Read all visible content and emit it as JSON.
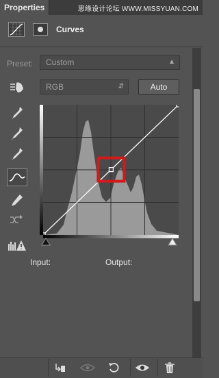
{
  "panel": {
    "tab_label": "Properties",
    "watermark": "思缘设计论坛 WWW.MISSYUAN.COM"
  },
  "header": {
    "title": "Curves",
    "adjustment_icon": "curves-grid-icon",
    "mask_icon": "mask-icon"
  },
  "preset": {
    "label": "Preset:",
    "value": "Custom"
  },
  "channel": {
    "value": "RGB"
  },
  "auto_button": {
    "label": "Auto"
  },
  "tools": [
    {
      "name": "on-image-adjust-icon"
    },
    {
      "name": "eyedropper-black-icon"
    },
    {
      "name": "eyedropper-gray-icon"
    },
    {
      "name": "eyedropper-white-icon"
    },
    {
      "name": "curve-points-icon",
      "active": true
    },
    {
      "name": "pencil-icon"
    },
    {
      "name": "smooth-icon"
    },
    {
      "name": "clipping-warning-icon"
    }
  ],
  "curve": {
    "points": [
      [
        0,
        0
      ],
      [
        128,
        128
      ],
      [
        255,
        255
      ]
    ],
    "highlight_color": "#d11a1a"
  },
  "labels": {
    "input": "Input:",
    "output": "Output:"
  },
  "bottom_tools": [
    "clip-to-layer-icon",
    "view-previous-icon",
    "reset-icon",
    "visibility-eye-icon",
    "delete-icon"
  ]
}
